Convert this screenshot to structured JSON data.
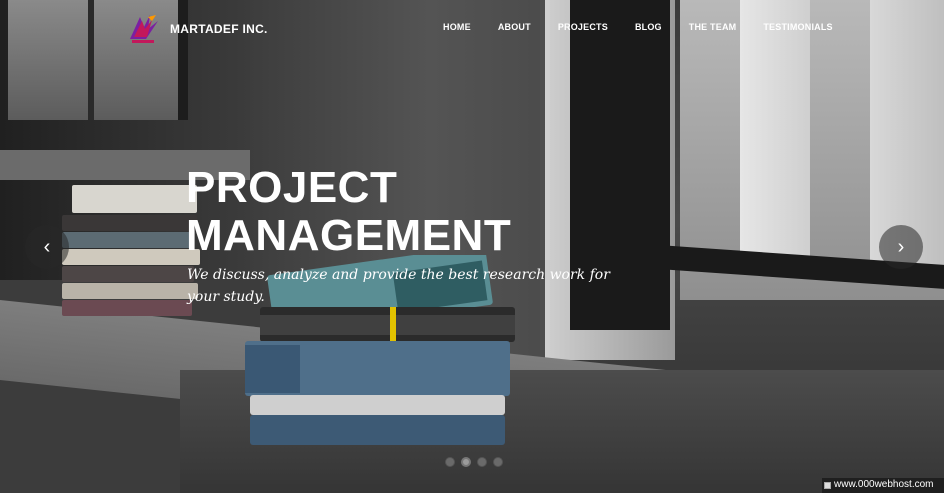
{
  "brand": {
    "name": "MARTADEF INC.",
    "logo_icon": "martadef-logo-icon"
  },
  "nav": {
    "items": [
      {
        "label": "HOME"
      },
      {
        "label": "ABOUT"
      },
      {
        "label": "PROJECTS"
      },
      {
        "label": "BLOG"
      },
      {
        "label": "THE TEAM"
      },
      {
        "label": "TESTIMONIALS"
      }
    ]
  },
  "hero": {
    "title_line1": "PROJECT",
    "title_line2": "MANAGEMENT",
    "subtitle": "We discuss, analyze and provide the best research work for your study."
  },
  "carousel": {
    "prev_icon": "chevron-left-icon",
    "next_icon": "chevron-right-icon",
    "prev_glyph": "‹",
    "next_glyph": "›",
    "slide_count": 4,
    "active_index": 1
  },
  "footer_badge": {
    "text": "www.000webhost.com"
  },
  "colors": {
    "text": "#ffffff",
    "logo_primary": "#c2185b",
    "logo_accent": "#7b1fa2"
  }
}
